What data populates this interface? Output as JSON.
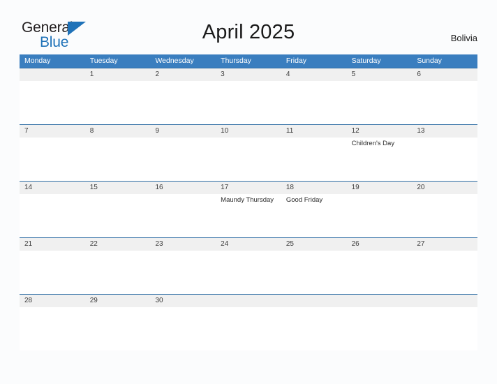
{
  "header": {
    "logo": {
      "word1": "General",
      "word2": "Blue",
      "triangle_icon": "triangle-icon"
    },
    "title": "April 2025",
    "country": "Bolivia"
  },
  "colors": {
    "header_band": "#3a7ebf",
    "row_rule": "#2e6da4",
    "date_strip": "#f0f0f0",
    "logo_blue": "#1f72b8",
    "page_background": "#fbfcfd",
    "text": "#1a1a1a"
  },
  "calendar": {
    "month": "April",
    "year": "2025",
    "weekday_headers": [
      "Monday",
      "Tuesday",
      "Wednesday",
      "Thursday",
      "Friday",
      "Saturday",
      "Sunday"
    ],
    "weeks": [
      [
        {
          "day": "",
          "event": ""
        },
        {
          "day": "1",
          "event": ""
        },
        {
          "day": "2",
          "event": ""
        },
        {
          "day": "3",
          "event": ""
        },
        {
          "day": "4",
          "event": ""
        },
        {
          "day": "5",
          "event": ""
        },
        {
          "day": "6",
          "event": ""
        }
      ],
      [
        {
          "day": "7",
          "event": ""
        },
        {
          "day": "8",
          "event": ""
        },
        {
          "day": "9",
          "event": ""
        },
        {
          "day": "10",
          "event": ""
        },
        {
          "day": "11",
          "event": ""
        },
        {
          "day": "12",
          "event": "Children's Day"
        },
        {
          "day": "13",
          "event": ""
        }
      ],
      [
        {
          "day": "14",
          "event": ""
        },
        {
          "day": "15",
          "event": ""
        },
        {
          "day": "16",
          "event": ""
        },
        {
          "day": "17",
          "event": "Maundy Thursday"
        },
        {
          "day": "18",
          "event": "Good Friday"
        },
        {
          "day": "19",
          "event": ""
        },
        {
          "day": "20",
          "event": ""
        }
      ],
      [
        {
          "day": "21",
          "event": ""
        },
        {
          "day": "22",
          "event": ""
        },
        {
          "day": "23",
          "event": ""
        },
        {
          "day": "24",
          "event": ""
        },
        {
          "day": "25",
          "event": ""
        },
        {
          "day": "26",
          "event": ""
        },
        {
          "day": "27",
          "event": ""
        }
      ],
      [
        {
          "day": "28",
          "event": ""
        },
        {
          "day": "29",
          "event": ""
        },
        {
          "day": "30",
          "event": ""
        },
        {
          "day": "",
          "event": ""
        },
        {
          "day": "",
          "event": ""
        },
        {
          "day": "",
          "event": ""
        },
        {
          "day": "",
          "event": ""
        }
      ]
    ]
  }
}
